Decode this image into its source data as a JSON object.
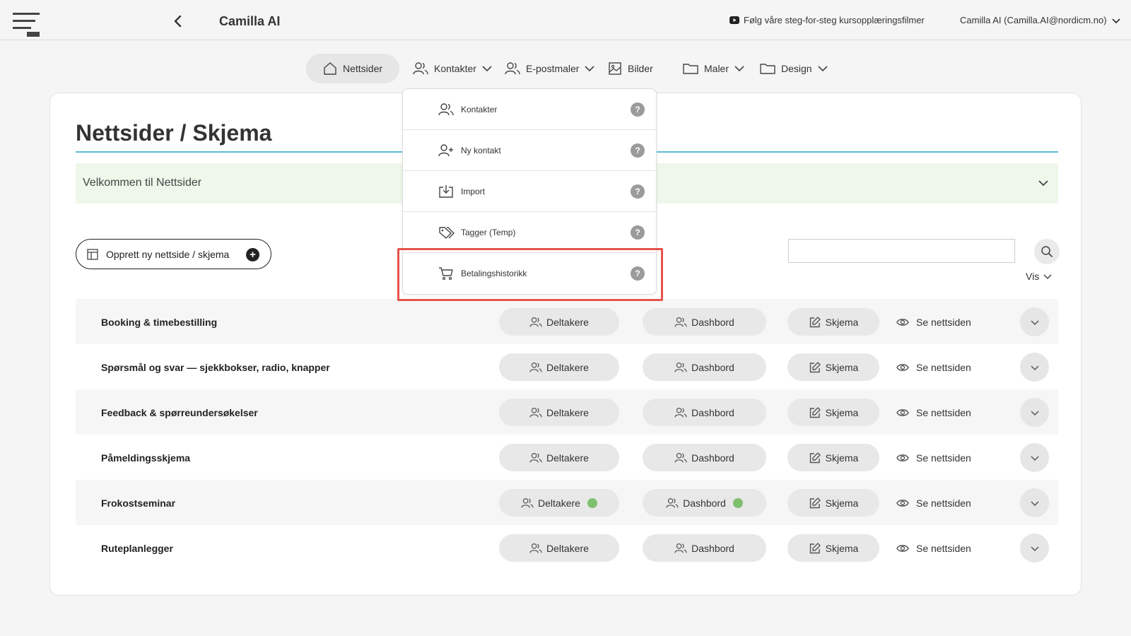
{
  "header": {
    "app_title": "Camilla AI",
    "tutorial_link": "Følg våre steg-for-steg kursopplæringsfilmer",
    "user": "Camilla AI (Camilla.AI@nordicm.no)"
  },
  "nav": {
    "nettsider": "Nettsider",
    "kontakter": "Kontakter",
    "epostmaler": "E-postmaler",
    "bilder": "Bilder",
    "maler": "Maler",
    "design": "Design"
  },
  "dropdown": {
    "items": [
      {
        "label": "Kontakter",
        "icon": "users-icon"
      },
      {
        "label": "Ny kontakt",
        "icon": "user-plus-icon"
      },
      {
        "label": "Import",
        "icon": "import-icon"
      },
      {
        "label": "Tagger (Temp)",
        "icon": "tags-icon"
      },
      {
        "label": "Betalingshistorikk",
        "icon": "cart-icon"
      }
    ],
    "help_symbol": "?"
  },
  "main": {
    "title": "Nettsider / Skjema",
    "welcome": "Velkommen til Nettsider",
    "create_button": "Opprett ny nettside / skjema",
    "create_plus": "+",
    "search_placeholder": "",
    "vis": "Vis"
  },
  "row_actions": {
    "deltakere": "Deltakere",
    "dashbord": "Dashbord",
    "skjema": "Skjema",
    "se_nettsiden": "Se nettsiden"
  },
  "rows": [
    {
      "name": "Booking & timebestilling",
      "status_dots": false
    },
    {
      "name": "Spørsmål og svar — sjekkbokser, radio, knapper",
      "status_dots": false
    },
    {
      "name": "Feedback & spørreundersøkelser",
      "status_dots": false
    },
    {
      "name": "Påmeldingsskjema",
      "status_dots": false
    },
    {
      "name": "Frokostseminar",
      "status_dots": true
    },
    {
      "name": "Ruteplanlegger",
      "status_dots": false
    }
  ],
  "colors": {
    "accent_line": "#5bbdd4",
    "welcome_bg": "#eef7ea",
    "status_dot": "#7fc06f",
    "highlight": "#e5534b"
  }
}
